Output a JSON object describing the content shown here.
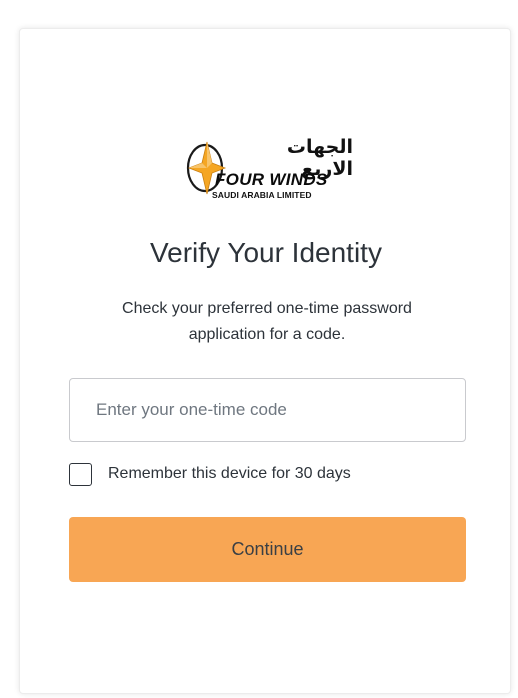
{
  "logo": {
    "arabic_text": "الجهات الاربع",
    "brand_text": "FOUR WINDS",
    "sub_text": "SAUDI ARABIA LIMITED",
    "emblem_icon": "compass-star-icon",
    "emblem_color": "#f5a623"
  },
  "header": {
    "title": "Verify Your Identity",
    "description": "Check your preferred one-time password application for a code."
  },
  "form": {
    "code_input": {
      "value": "",
      "placeholder": "Enter your one-time code"
    },
    "remember": {
      "label": "Remember this device for 30 days",
      "checked": false
    },
    "continue_label": "Continue"
  },
  "colors": {
    "accent": "#f8a654",
    "text": "#2d333a",
    "border": "#c9cace"
  }
}
